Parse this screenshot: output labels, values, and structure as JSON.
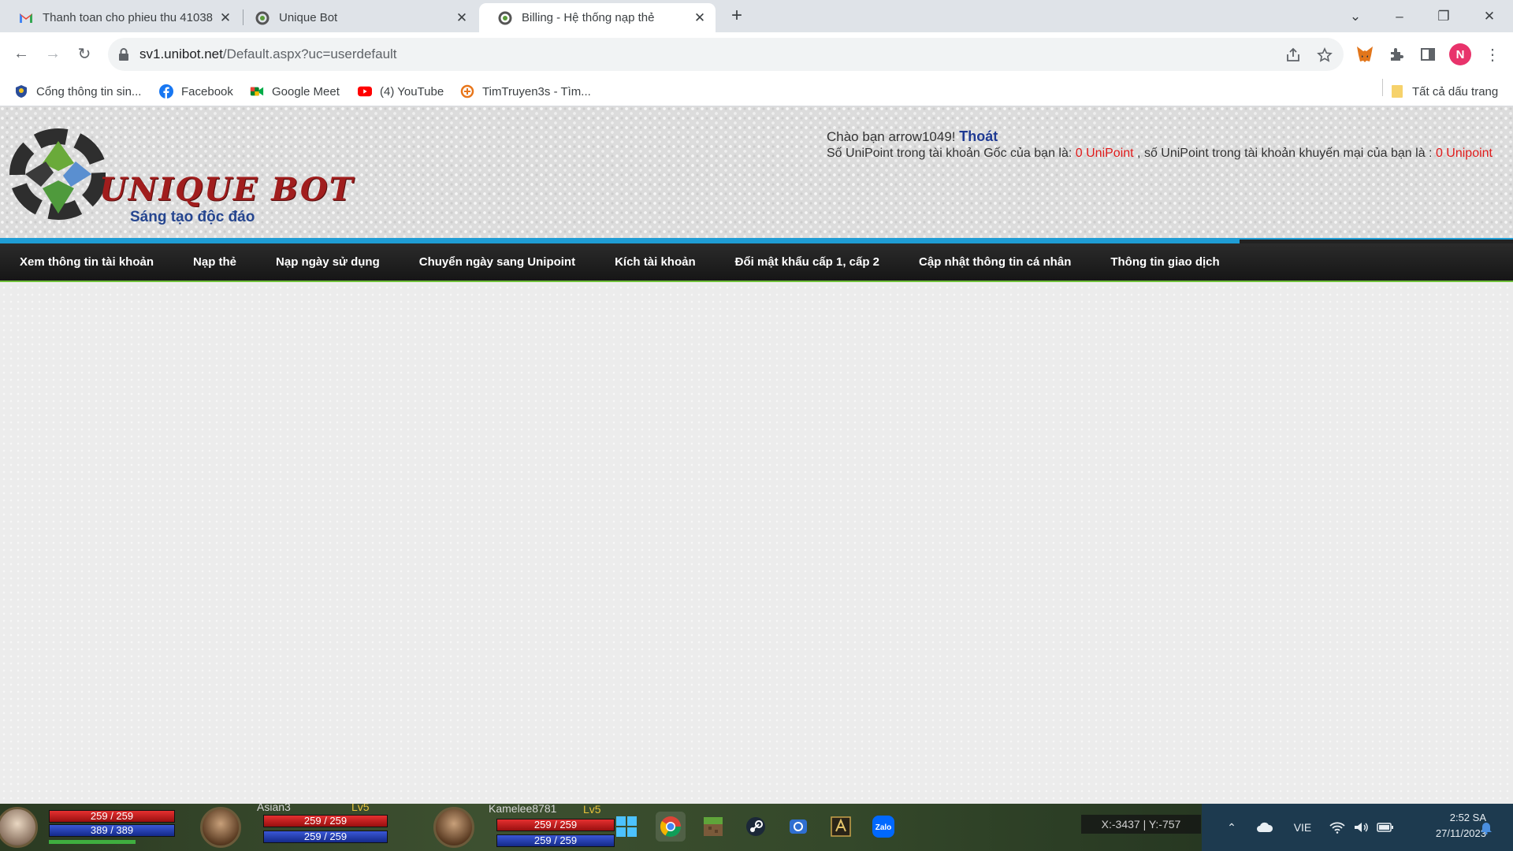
{
  "browser": {
    "tabs": [
      {
        "title": "Thanh toan cho phieu thu 41038",
        "icon": "gmail-icon"
      },
      {
        "title": "Unique Bot",
        "icon": "unibot-icon"
      },
      {
        "title": "Billing - Hệ thống nạp thẻ",
        "icon": "unibot-icon"
      }
    ],
    "url_host": "sv1.unibot.net",
    "url_path": "/Default.aspx?uc=userdefault",
    "profile_initial": "N",
    "bookmarks": [
      {
        "label": "Cổng thông tin sin...",
        "icon": "portal-icon"
      },
      {
        "label": "Facebook",
        "icon": "facebook-icon"
      },
      {
        "label": "Google Meet",
        "icon": "google-meet-icon"
      },
      {
        "label": "(4) YouTube",
        "icon": "youtube-icon"
      },
      {
        "label": "TimTruyen3s - Tìm...",
        "icon": "timtruyen-icon"
      }
    ],
    "all_bookmarks": "Tất cả dấu trang"
  },
  "header": {
    "logo_text": "UNIQUE BOT",
    "slogan": "Sáng tạo độc đáo",
    "greeting_prefix": "Chào bạn arrow1049!",
    "logout": "Thoát",
    "balance_text_1": "Số UniPoint trong tài khoản Gốc của bạn là:",
    "balance_main": "0 UniPoint",
    "balance_text_2": ", số UniPoint trong tài khoản khuyến mại của bạn là :",
    "balance_promo": "0 Unipoint"
  },
  "menu": [
    "Xem thông tin tài khoản",
    "Nạp thẻ",
    "Nạp ngày sử dụng",
    "Chuyển ngày sang Unipoint",
    "Kích tài khoản",
    "Đổi mật khẩu cấp 1, cấp 2",
    "Cập nhật thông tin cá nhân",
    "Thông tin giao dịch"
  ],
  "game": {
    "players": [
      {
        "name": "",
        "level": "",
        "hp": "259 / 259",
        "mp": "389 / 389"
      },
      {
        "name": "Asian3",
        "level": "Lv5",
        "hp": "259 / 259",
        "mp": "259 / 259"
      },
      {
        "name": "Kamelee8781",
        "level": "Lv5",
        "hp": "259 / 259",
        "mp": "259 / 259"
      }
    ],
    "coords": "X:-3437 | Y:-757"
  },
  "system": {
    "language": "VIE",
    "time": "2:52 SA",
    "date": "27/11/2023"
  },
  "colors": {
    "accent_blue": "#1f9dd5",
    "menu_bg": "#1e1e1e",
    "highlight_red": "#e01b1b",
    "logout_blue": "#1f3a93"
  }
}
